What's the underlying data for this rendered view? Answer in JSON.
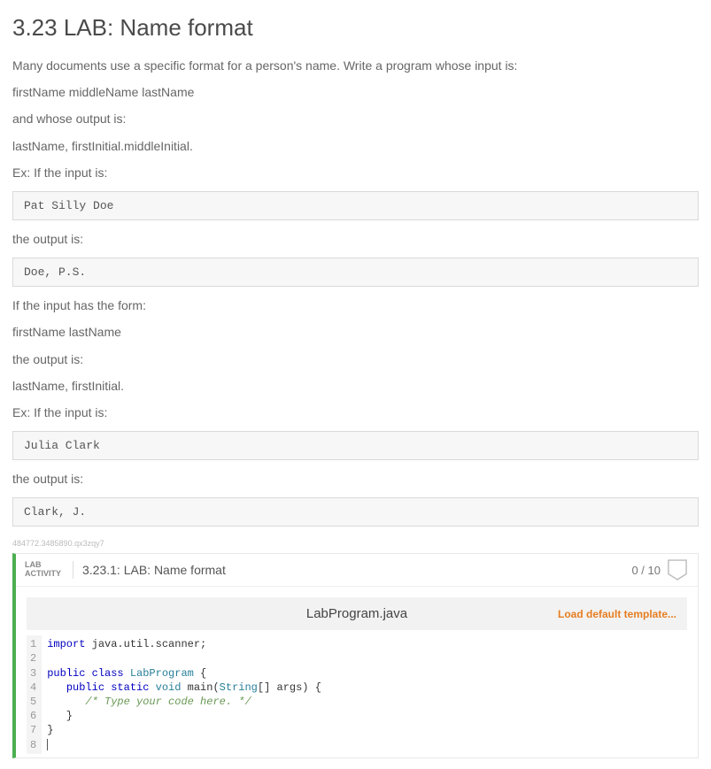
{
  "title": "3.23 LAB: Name format",
  "paragraphs": {
    "intro": "Many documents use a specific format for a person's name. Write a program whose input is:",
    "inputFormat": "firstName middleName lastName",
    "andOutput": "and whose output is:",
    "outputFormat": "lastName, firstInitial.middleInitial.",
    "ex1": "Ex: If the input is:",
    "output_is": "the output is:",
    "ifInputForm": "If the input has the form:",
    "inputFormat2": "firstName lastName",
    "output_is2": "the output is:",
    "outputFormat2": "lastName, firstInitial.",
    "ex2": "Ex: If the input is:",
    "output_is3": "the output is:"
  },
  "boxes": {
    "input1": "Pat Silly Doe",
    "output1": "Doe, P.S.",
    "input2": "Julia Clark",
    "output2": "Clark, J."
  },
  "tiny_id": "484772.3485890.qx3zqy7",
  "lab": {
    "tag_line1": "LAB",
    "tag_line2": "ACTIVITY",
    "title": "3.23.1: LAB: Name format",
    "score": "0 / 10",
    "filename": "LabProgram.java",
    "load_template": "Load default template...",
    "code": [
      {
        "n": "1",
        "raw": "import java.util.Scanner;",
        "tokens": [
          [
            "kw",
            "import"
          ],
          [
            "pkg",
            " java.util.scanner;"
          ]
        ]
      },
      {
        "n": "2",
        "raw": "",
        "tokens": []
      },
      {
        "n": "3",
        "raw": "public class LabProgram {",
        "tokens": [
          [
            "kw",
            "public class "
          ],
          [
            "cls",
            "LabProgram"
          ],
          [
            "pkg",
            " {"
          ]
        ]
      },
      {
        "n": "4",
        "raw": "   public static void main(String[] args) {",
        "tokens": [
          [
            "pkg",
            "   "
          ],
          [
            "kw",
            "public static "
          ],
          [
            "type",
            "void"
          ],
          [
            "pkg",
            " main("
          ],
          [
            "type",
            "String"
          ],
          [
            "pkg",
            "[] args) {"
          ]
        ]
      },
      {
        "n": "5",
        "raw": "      /* Type your code here. */",
        "tokens": [
          [
            "pkg",
            "      "
          ],
          [
            "com",
            "/* Type your code here. */"
          ]
        ]
      },
      {
        "n": "6",
        "raw": "   }",
        "tokens": [
          [
            "pkg",
            "   }"
          ]
        ]
      },
      {
        "n": "7",
        "raw": "}",
        "tokens": [
          [
            "pkg",
            "}"
          ]
        ]
      },
      {
        "n": "8",
        "raw": "",
        "tokens": []
      }
    ]
  }
}
